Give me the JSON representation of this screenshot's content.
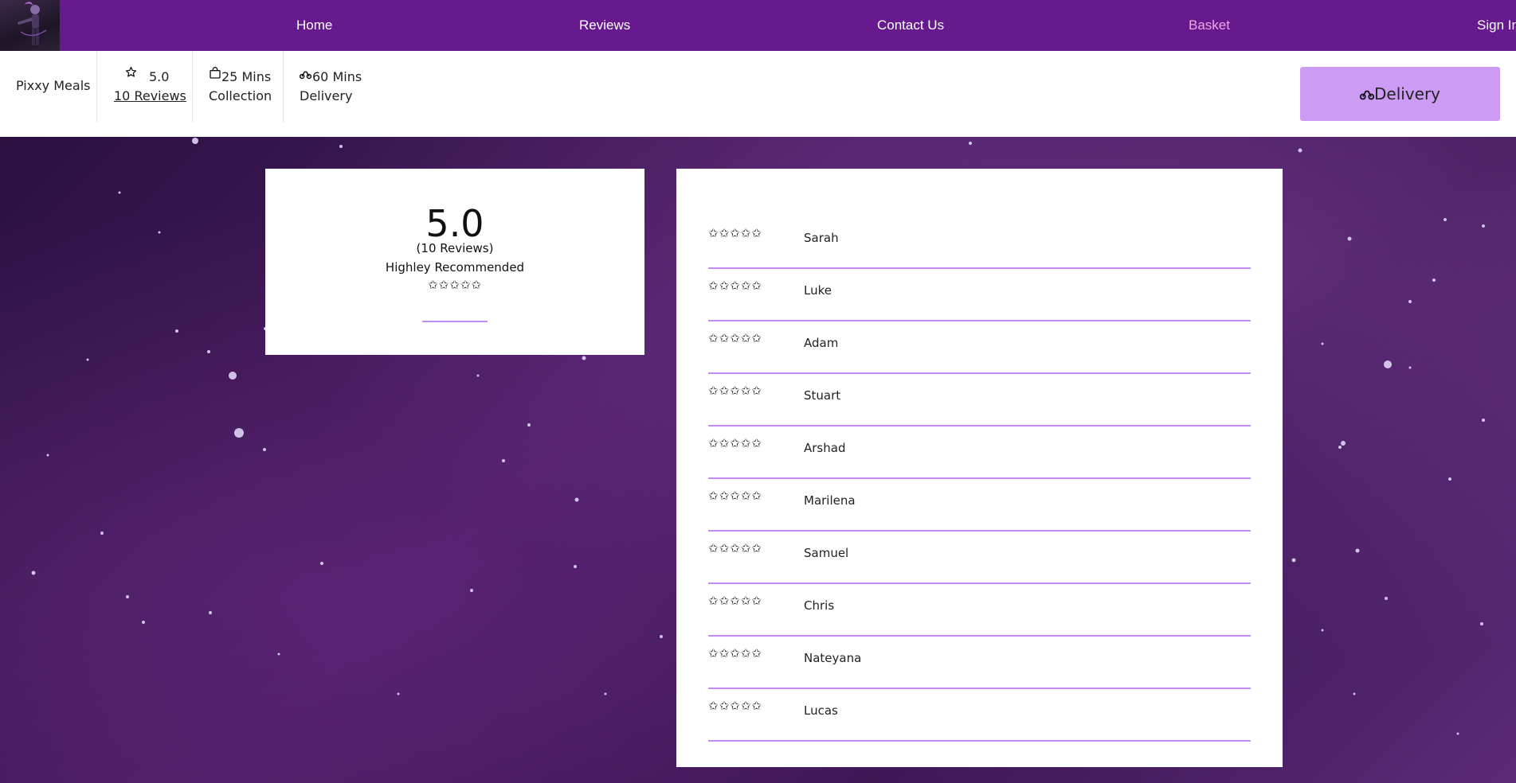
{
  "nav": {
    "links": [
      {
        "label": "Home"
      },
      {
        "label": "Reviews"
      },
      {
        "label": "Contact Us"
      },
      {
        "label": "Basket"
      },
      {
        "label": "Sign In"
      }
    ],
    "active_color": "#f0a7e4",
    "bg_color": "#661a8e"
  },
  "info": {
    "restaurant_name": "Pixxy Meals",
    "rating": "5.0",
    "reviews_link": "10 Reviews",
    "collection_time": "25 Mins",
    "collection_label": "Collection",
    "delivery_time": "60 Mins",
    "delivery_label": "Delivery",
    "icons": [
      "star-outline-icon",
      "bag-icon",
      "bike-icon"
    ]
  },
  "delivery_button": {
    "label": "Delivery",
    "icon": "bike-icon",
    "color": "#cc9cf4"
  },
  "summary": {
    "score": "5.0",
    "count": "(10 Reviews)",
    "recommendation": "Highley Recommended",
    "stars": "✩✩✩✩✩"
  },
  "reviews": [
    {
      "stars": "✩✩✩✩✩",
      "name": "Sarah"
    },
    {
      "stars": "✩✩✩✩✩",
      "name": "Luke"
    },
    {
      "stars": "✩✩✩✩✩",
      "name": "Adam"
    },
    {
      "stars": "✩✩✩✩✩",
      "name": "Stuart"
    },
    {
      "stars": "✩✩✩✩✩",
      "name": "Arshad"
    },
    {
      "stars": "✩✩✩✩✩",
      "name": "Marilena"
    },
    {
      "stars": "✩✩✩✩✩",
      "name": "Samuel"
    },
    {
      "stars": "✩✩✩✩✩",
      "name": "Chris"
    },
    {
      "stars": "✩✩✩✩✩",
      "name": "Nateyana"
    },
    {
      "stars": "✩✩✩✩✩",
      "name": "Lucas"
    }
  ],
  "accent_color": "#c48bf2"
}
